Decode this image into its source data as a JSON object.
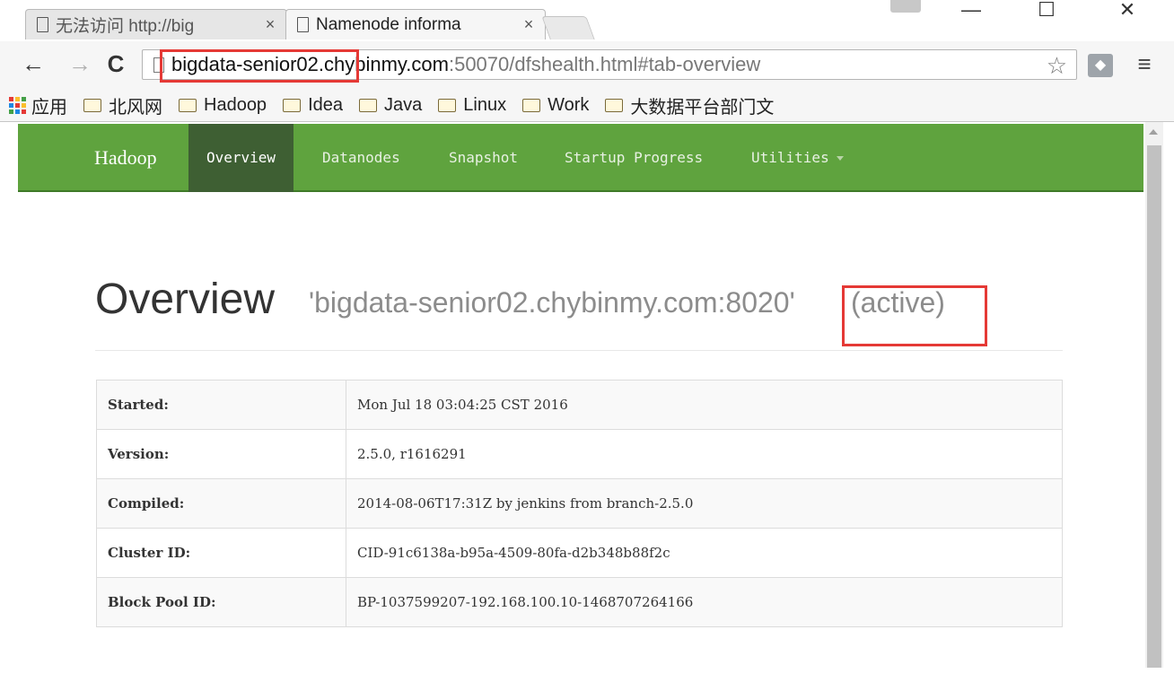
{
  "browser": {
    "tabs": [
      {
        "title": "无法访问 http://big",
        "close": "×",
        "active": false
      },
      {
        "title": "Namenode informa",
        "close": "×",
        "active": true
      }
    ],
    "window_controls": {
      "minimize": "—",
      "maximize": "☐",
      "close": "✕"
    },
    "nav": {
      "back": "←",
      "forward": "→",
      "reload": "C"
    },
    "address": {
      "host": "bigdata-senior02.chybinmy.com",
      "rest": ":50070/dfshealth.html#tab-overview"
    },
    "bookmark_star_icon": "star-icon",
    "menu_icon": "≡",
    "bookmarks": [
      {
        "label": "应用",
        "icon": "apps-icon"
      },
      {
        "label": "北风网",
        "icon": "folder-icon"
      },
      {
        "label": "Hadoop",
        "icon": "folder-icon"
      },
      {
        "label": "Idea",
        "icon": "folder-icon"
      },
      {
        "label": "Java",
        "icon": "folder-icon"
      },
      {
        "label": "Linux",
        "icon": "folder-icon"
      },
      {
        "label": "Work",
        "icon": "folder-icon"
      },
      {
        "label": "大数据平台部门文",
        "icon": "folder-icon"
      }
    ]
  },
  "navbar": {
    "brand": "Hadoop",
    "items": [
      {
        "label": "Overview",
        "active": true
      },
      {
        "label": "Datanodes",
        "active": false
      },
      {
        "label": "Snapshot",
        "active": false
      },
      {
        "label": "Startup Progress",
        "active": false
      },
      {
        "label": "Utilities",
        "active": false
      }
    ],
    "color": "#5fa33e",
    "active_color": "#3e5f33"
  },
  "header": {
    "title": "Overview",
    "subtitle": "'bigdata-senior02.chybinmy.com:8020'",
    "status": "(active)"
  },
  "table": {
    "rows": [
      {
        "key": "Started:",
        "value": "Mon Jul 18 03:04:25 CST 2016"
      },
      {
        "key": "Version:",
        "value": "2.5.0, r1616291"
      },
      {
        "key": "Compiled:",
        "value": "2014-08-06T17:31Z by jenkins from branch-2.5.0"
      },
      {
        "key": "Cluster ID:",
        "value": "CID-91c6138a-b95a-4509-80fa-d2b348b88f2c"
      },
      {
        "key": "Block Pool ID:",
        "value": "BP-1037599207-192.168.100.10-1468707264166"
      }
    ]
  },
  "annotation_color": "#e53935"
}
